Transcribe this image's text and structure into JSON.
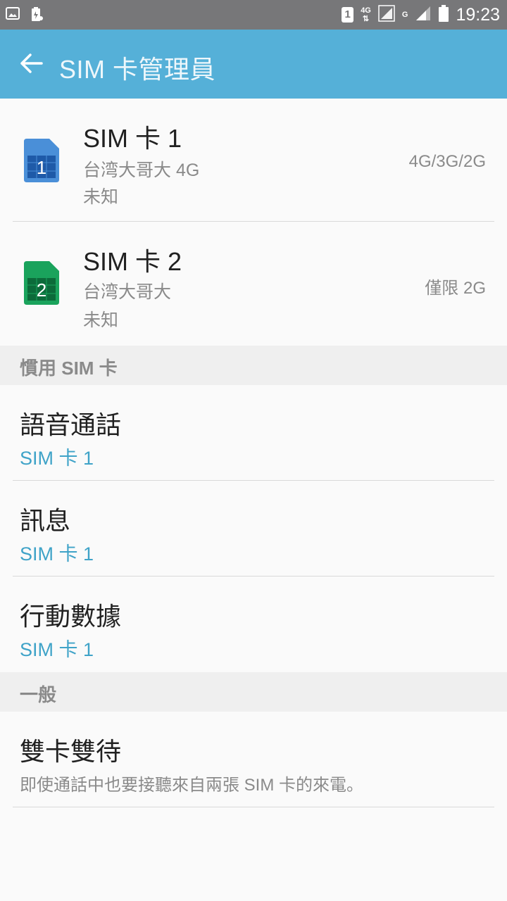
{
  "status_bar": {
    "time": "19:23",
    "sim1_badge": "1",
    "net1_label": "4G",
    "net2_label": "G",
    "icons": [
      "gallery-icon",
      "battery-saver-icon",
      "sim-1-icon",
      "signal-icon",
      "signal-icon",
      "battery-icon"
    ]
  },
  "app_bar": {
    "title": "SIM 卡管理員",
    "back_icon": "arrow-left-icon"
  },
  "sims": [
    {
      "badge": "1",
      "name": "SIM 卡 1",
      "carrier": "台湾大哥大 4G",
      "status": "未知",
      "network": "4G/3G/2G",
      "color": "#4a8fd8"
    },
    {
      "badge": "2",
      "name": "SIM 卡 2",
      "carrier": "台湾大哥大",
      "status": "未知",
      "network": "僅限 2G",
      "color": "#1aa35c"
    }
  ],
  "preferred_section": {
    "header": "慣用 SIM 卡",
    "items": [
      {
        "title": "語音通話",
        "value": "SIM 卡 1"
      },
      {
        "title": "訊息",
        "value": "SIM 卡 1"
      },
      {
        "title": "行動數據",
        "value": "SIM 卡 1"
      }
    ]
  },
  "general_section": {
    "header": "一般",
    "dual_standby": {
      "title": "雙卡雙待",
      "description": "即使通話中也要接聽來自兩張 SIM 卡的來電。"
    }
  },
  "colors": {
    "accent": "#55b0d8",
    "link": "#3fa3c8",
    "status_bar": "#777779"
  }
}
